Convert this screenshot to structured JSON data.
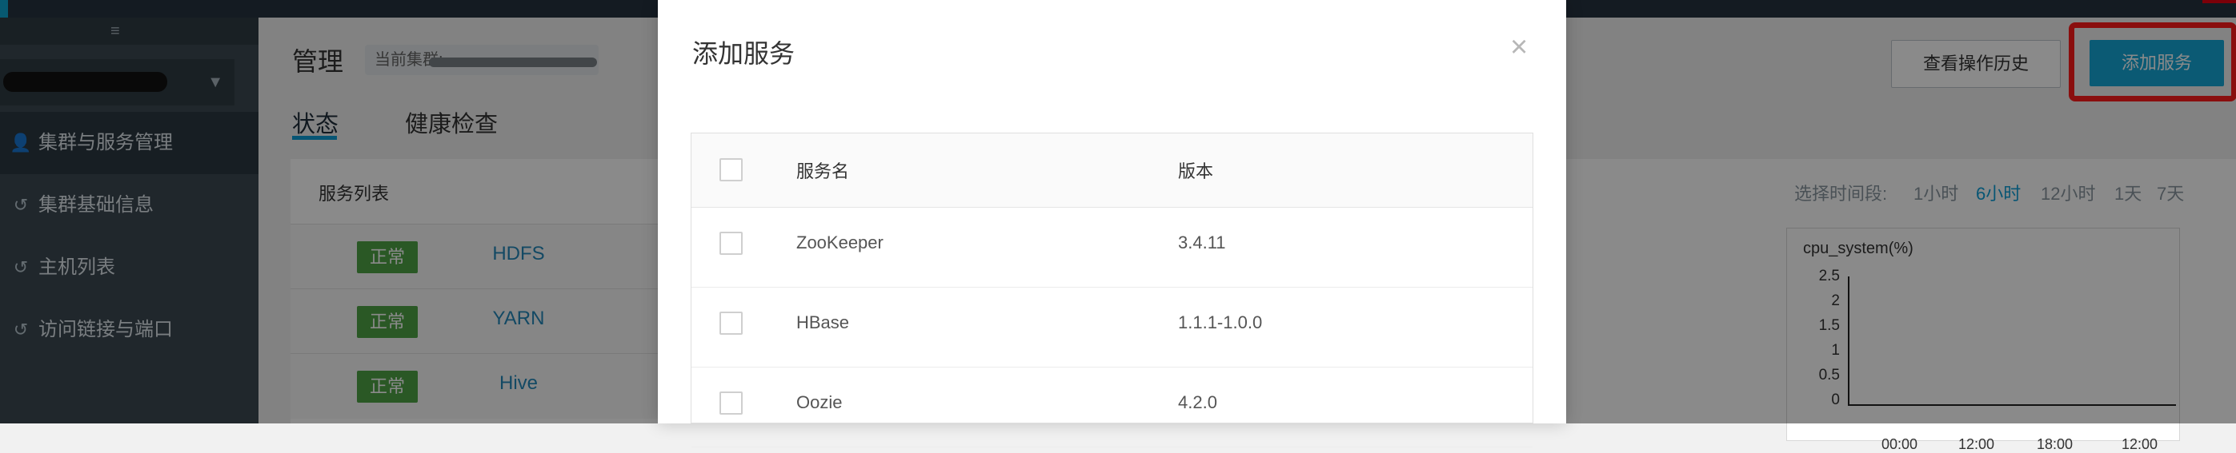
{
  "sidebar": {
    "items": [
      {
        "icon": "user-icon",
        "label": "集群与服务管理",
        "active": true
      },
      {
        "icon": "history-icon",
        "label": "集群基础信息",
        "active": false
      },
      {
        "icon": "history-icon",
        "label": "主机列表",
        "active": false
      },
      {
        "icon": "history-icon",
        "label": "访问链接与端口",
        "active": false
      }
    ]
  },
  "header": {
    "title": "管理",
    "current_cluster_label": "当前集群:",
    "history_button": "查看操作历史",
    "add_service_button": "添加服务"
  },
  "tabs": [
    {
      "label": "状态",
      "active": true
    },
    {
      "label": "健康检查",
      "active": false
    }
  ],
  "service_list": {
    "title": "服务列表",
    "rows": [
      {
        "status": "正常",
        "name": "HDFS"
      },
      {
        "status": "正常",
        "name": "YARN"
      },
      {
        "status": "正常",
        "name": "Hive"
      }
    ]
  },
  "time_range": {
    "label": "选择时间段:",
    "options": [
      "1小时",
      "6小时",
      "12小时",
      "1天",
      "7天"
    ],
    "selected": "6小时"
  },
  "chart": {
    "title": "cpu_system(%)",
    "y_ticks": [
      "2.5",
      "2",
      "1.5",
      "1",
      "0.5",
      "0"
    ],
    "x_ticks": [
      "00:00",
      "12:00",
      "18:00",
      "12:00"
    ]
  },
  "modal": {
    "title": "添加服务",
    "columns": {
      "name": "服务名",
      "version": "版本"
    },
    "rows": [
      {
        "name": "ZooKeeper",
        "version": "3.4.11"
      },
      {
        "name": "HBase",
        "version": "1.1.1-1.0.0"
      },
      {
        "name": "Oozie",
        "version": "4.2.0"
      }
    ]
  },
  "colors": {
    "accent": "#0d9ed6",
    "add_button": "#15a7d7",
    "status_ok": "#4ea345",
    "highlight": "#ff1a1a",
    "sidebar": "#3b4852"
  }
}
